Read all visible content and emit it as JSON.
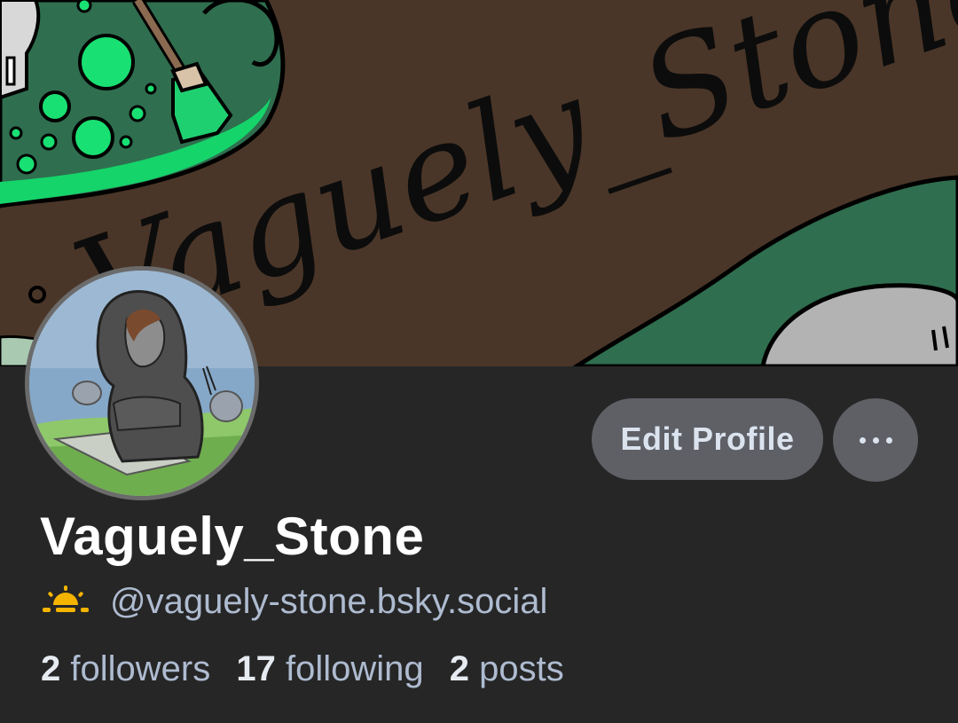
{
  "banner": {
    "text": "Vaguely_Stone"
  },
  "profile": {
    "display_name": "Vaguely_Stone",
    "handle": "@vaguely-stone.bsky.social",
    "edit_button": "Edit Profile",
    "more_icon": "more-horizontal-icon",
    "status_icon": "sunrise-icon",
    "status_icon_color": "#f4b400"
  },
  "stats": {
    "followers_count": "2",
    "followers_label": "followers",
    "following_count": "17",
    "following_label": "following",
    "posts_count": "2",
    "posts_label": "posts"
  }
}
